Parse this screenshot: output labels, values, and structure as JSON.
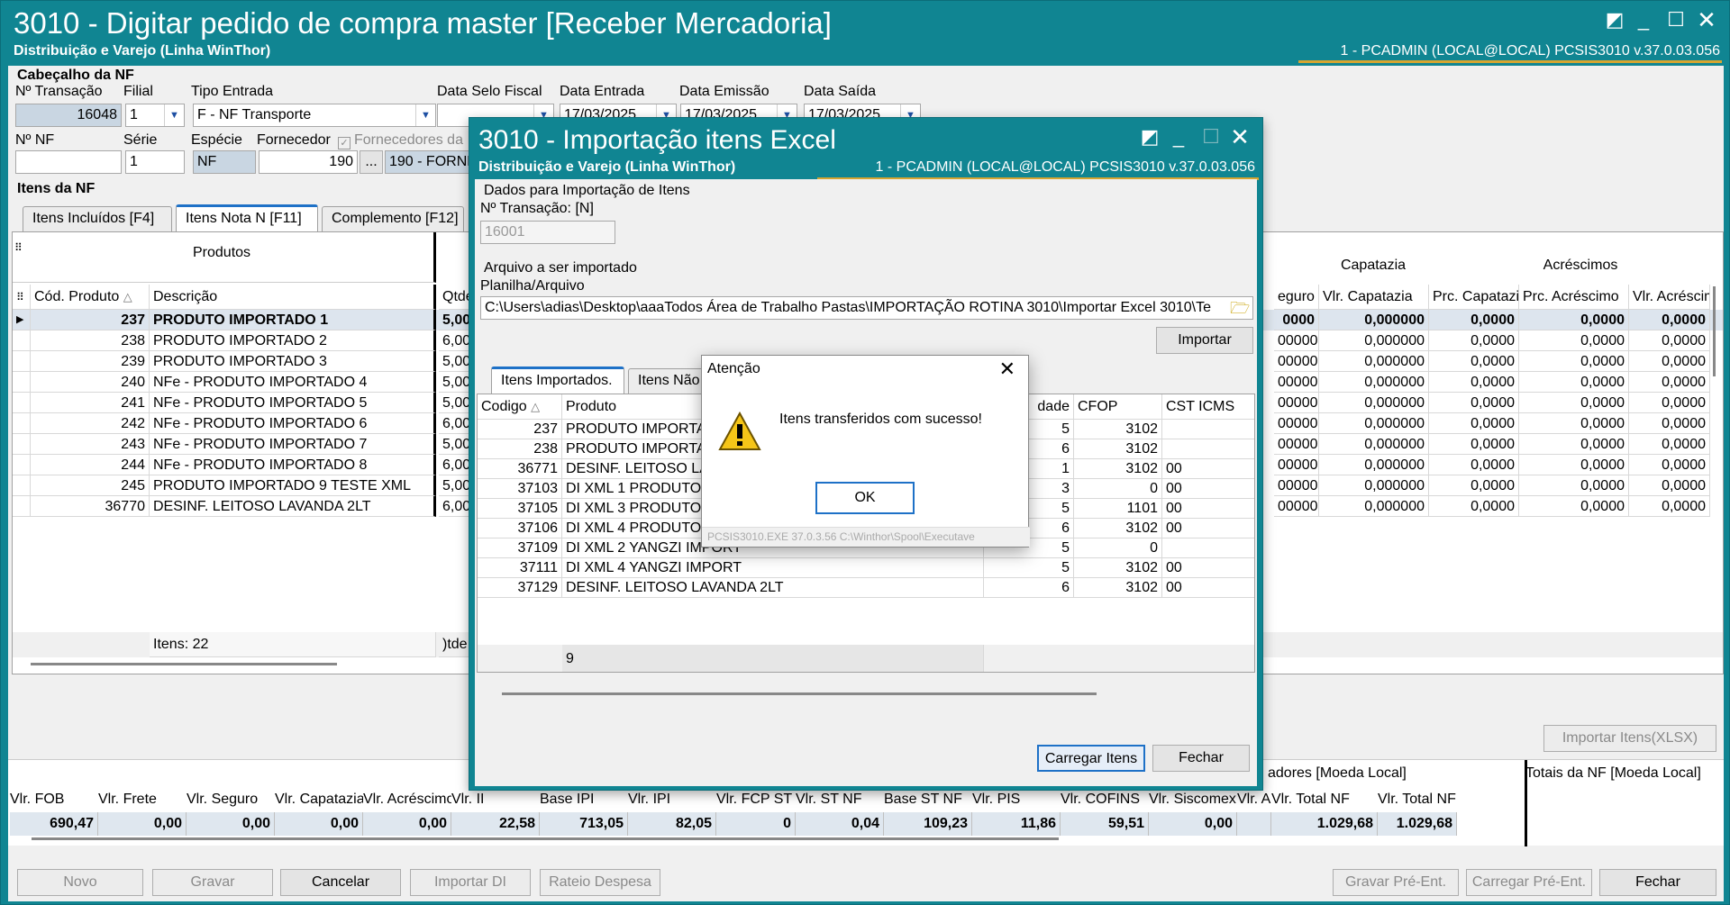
{
  "main": {
    "title": "3010 - Digitar pedido de compra master [Receber Mercadoria]",
    "subtitle": "Distribuição e Varejo (Linha WinThor)",
    "user_info": "1 - PCADMIN (LOCAL@LOCAL)   PCSIS3010  v.37.0.03.056"
  },
  "header": {
    "section": "Cabeçalho da NF",
    "transacao_label": "Nº Transação",
    "transacao": "16048",
    "filial_label": "Filial",
    "filial": "1",
    "tipo_entrada_label": "Tipo Entrada",
    "tipo_entrada": "F - NF Transporte",
    "data_selo_label": "Data Selo Fiscal",
    "data_entrada_label": "Data Entrada",
    "data_entrada": "17/03/2025",
    "data_emissao_label": "Data Emissão",
    "data_emissao": "17/03/2025",
    "data_saida_label": "Data Saída",
    "data_saida": "17/03/2025",
    "nf_label": "Nº NF",
    "nf": "",
    "serie_label": "Série",
    "serie": "1",
    "especie_label": "Espécie",
    "especie": "NF",
    "fornecedor_label": "Fornecedor",
    "fornecedor": "190",
    "fornecedor_nome": "190 - FORNE",
    "fornecedores_label": "Fornecedores da",
    "ellipsis": "..."
  },
  "items": {
    "section": "Itens da NF",
    "tabs": [
      "Itens Incluídos [F4]",
      "Itens Nota N [F11]",
      "Complemento [F12]"
    ],
    "group_produtos": "Produtos",
    "group_capatazia": "Capatazia",
    "group_acrescimos": "Acréscimos",
    "col_cod": "Cód. Produto",
    "col_desc": "Descrição",
    "col_qtde": "Qtde",
    "right_cols": [
      "eguro",
      "Vlr. Capatazia",
      "Prc. Capatazia",
      "Prc. Acréscimo",
      "Vlr. Acréscim"
    ],
    "rows": [
      {
        "cod": "237",
        "desc": "PRODUTO IMPORTADO 1",
        "qtde": "5,00",
        "v": [
          "0000",
          "0,000000",
          "0,0000",
          "0,0000",
          "0,0000"
        ]
      },
      {
        "cod": "238",
        "desc": "PRODUTO IMPORTADO 2",
        "qtde": "6,00",
        "v": [
          "00000",
          "0,000000",
          "0,0000",
          "0,0000",
          "0,0000"
        ]
      },
      {
        "cod": "239",
        "desc": "PRODUTO IMPORTADO 3",
        "qtde": "5,00",
        "v": [
          "00000",
          "0,000000",
          "0,0000",
          "0,0000",
          "0,0000"
        ]
      },
      {
        "cod": "240",
        "desc": "NFe - PRODUTO IMPORTADO 4",
        "qtde": "5,00",
        "v": [
          "00000",
          "0,000000",
          "0,0000",
          "0,0000",
          "0,0000"
        ]
      },
      {
        "cod": "241",
        "desc": "NFe - PRODUTO IMPORTADO 5",
        "qtde": "5,00",
        "v": [
          "00000",
          "0,000000",
          "0,0000",
          "0,0000",
          "0,0000"
        ]
      },
      {
        "cod": "242",
        "desc": "NFe - PRODUTO IMPORTADO 6",
        "qtde": "6,00",
        "v": [
          "00000",
          "0,000000",
          "0,0000",
          "0,0000",
          "0,0000"
        ]
      },
      {
        "cod": "243",
        "desc": "NFe - PRODUTO IMPORTADO 7",
        "qtde": "5,00",
        "v": [
          "00000",
          "0,000000",
          "0,0000",
          "0,0000",
          "0,0000"
        ]
      },
      {
        "cod": "244",
        "desc": "NFe - PRODUTO IMPORTADO 8",
        "qtde": "6,00",
        "v": [
          "00000",
          "0,000000",
          "0,0000",
          "0,0000",
          "0,0000"
        ]
      },
      {
        "cod": "245",
        "desc": "PRODUTO IMPORTADO 9 TESTE XML",
        "qtde": "5,00",
        "v": [
          "00000",
          "0,000000",
          "0,0000",
          "0,0000",
          "0,0000"
        ]
      },
      {
        "cod": "36770",
        "desc": "DESINF. LEITOSO LAVANDA 2LT",
        "qtde": "6,00",
        "v": [
          "00000",
          "0,000000",
          "0,0000",
          "0,0000",
          "0,0000"
        ]
      }
    ],
    "footer_itens": "Itens: 22",
    "footer_qtde": ")tde:",
    "import_xlsx": "Importar Itens(XLSX)"
  },
  "totals": {
    "totalizadores_title": "adores [Moeda Local]",
    "totais_title": "Totais da NF [Moeda Local]",
    "labels": [
      "Vlr. FOB",
      "Vlr. Frete",
      "Vlr. Seguro",
      "Vlr. Capatazia",
      "Vlr. Acréscimo",
      "Vlr. II",
      "Base IPI",
      "Vlr. IPI",
      "Vlr. FCP ST",
      "Vlr. ST NF",
      "Base ST NF",
      "Vlr. PIS",
      "Vlr. COFINS",
      "Vlr. Siscomex",
      "Vlr. A",
      "Vlr. Total NF",
      "Vlr. Total NF"
    ],
    "values": [
      "690,47",
      "0,00",
      "0,00",
      "0,00",
      "0,00",
      "22,58",
      "713,05",
      "82,05",
      "0",
      "0,04",
      "109,23",
      "11,86",
      "59,51",
      "0,00",
      "",
      "1.029,68",
      "1.029,68"
    ]
  },
  "buttons": {
    "novo": "Novo",
    "gravar": "Gravar",
    "cancelar": "Cancelar",
    "importar_di": "Importar DI",
    "rateio": "Rateio Despesa",
    "gravar_pre": "Gravar Pré-Ent.",
    "carregar_pre": "Carregar Pré-Ent.",
    "fechar": "Fechar"
  },
  "dialog": {
    "title": "3010 - Importação itens Excel",
    "subtitle": "Distribuição e Varejo (Linha WinThor)",
    "user_info": "1 - PCADMIN (LOCAL@LOCAL)   PCSIS3010  v.37.0.03.056",
    "group_dados": "Dados para Importação de Itens",
    "transacao_label": "Nº Transação: [N]",
    "transacao": "16001",
    "group_arquivo": "Arquivo a ser importado",
    "planilha_label": "Planilha/Arquivo",
    "path": "C:\\Users\\adias\\Desktop\\aaaTodos Área de Trabalho Pastas\\IMPORTAÇÃO ROTINA 3010\\Importar Excel 3010\\Te",
    "importar": "Importar",
    "tabs": [
      "Itens Importados.",
      "Itens Não"
    ],
    "col_codigo": "Codigo",
    "col_produto": "Produto",
    "col_qtd": "dade",
    "col_cfop": "CFOP",
    "col_cst": "CST ICMS",
    "rows": [
      {
        "codigo": "237",
        "produto": "PRODUTO IMPORTAD",
        "qtd": "5",
        "cfop": "3102",
        "cst": ""
      },
      {
        "codigo": "238",
        "produto": "PRODUTO IMPORTAD",
        "qtd": "6",
        "cfop": "3102",
        "cst": ""
      },
      {
        "codigo": "36771",
        "produto": "DESINF. LEITOSO LA",
        "qtd": "1",
        "cfop": "3102",
        "cst": "00"
      },
      {
        "codigo": "37103",
        "produto": "DI XML 1 PRODUTO I",
        "qtd": "3",
        "cfop": "0",
        "cst": "00"
      },
      {
        "codigo": "37105",
        "produto": "DI XML 3 PRODUTO I",
        "qtd": "5",
        "cfop": "1101",
        "cst": "00"
      },
      {
        "codigo": "37106",
        "produto": "DI XML 4 PRODUTO IMPORTADO",
        "qtd": "6",
        "cfop": "3102",
        "cst": "00"
      },
      {
        "codigo": "37109",
        "produto": "DI XML 2 YANGZI IMPORT",
        "qtd": "5",
        "cfop": "0",
        "cst": ""
      },
      {
        "codigo": "37111",
        "produto": "DI XML 4 YANGZI IMPORT",
        "qtd": "5",
        "cfop": "3102",
        "cst": "00"
      },
      {
        "codigo": "37129",
        "produto": "DESINF. LEITOSO LAVANDA 2LT",
        "qtd": "6",
        "cfop": "3102",
        "cst": "00"
      }
    ],
    "footer_count": "9",
    "carregar": "Carregar Itens",
    "fechar": "Fechar"
  },
  "message": {
    "title": "Atenção",
    "text": "Itens transferidos com sucesso!",
    "ok": "OK",
    "status": "PCSIS3010.EXE 37.0.3.56 C:\\Winthor\\Spool\\Executave"
  },
  "colors": {
    "titlebar": "#108592",
    "accent": "#d6a531",
    "selection": "#1e71c7"
  }
}
